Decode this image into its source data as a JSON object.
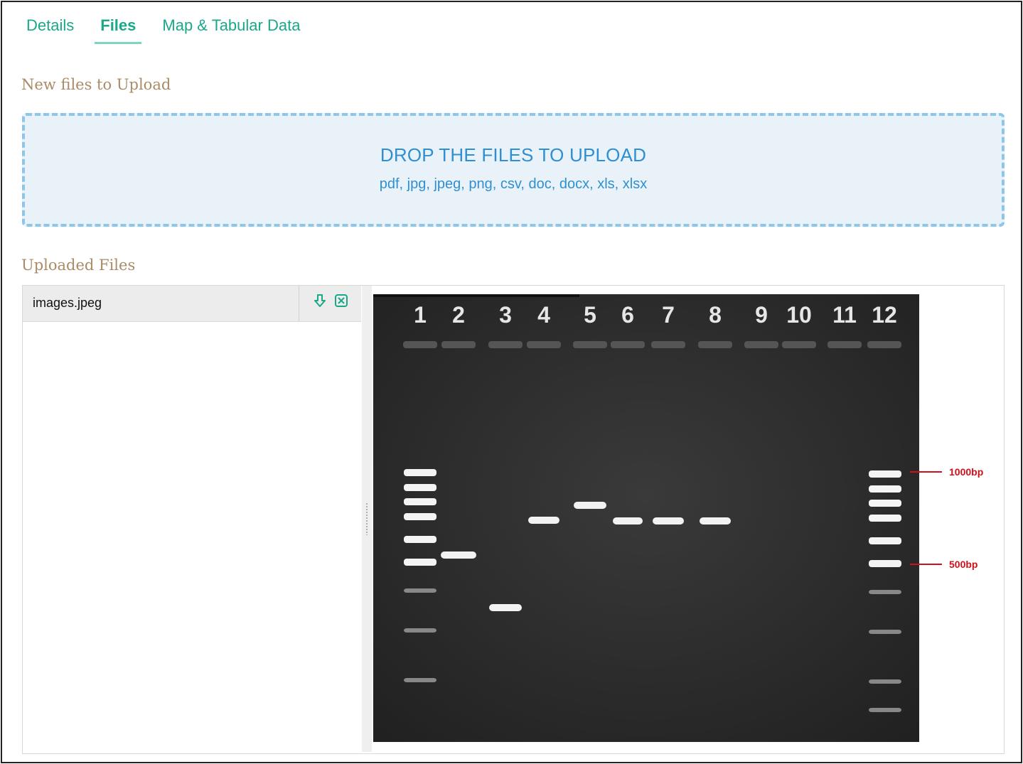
{
  "tabs": [
    "Details",
    "Files",
    "Map & Tabular Data"
  ],
  "active_tab": "Files",
  "new_files": {
    "title": "New files to Upload",
    "drop_label": "DROP THE FILES TO UPLOAD",
    "formats": "pdf, jpg, jpeg, png, csv, doc, docx, xls, xlsx"
  },
  "uploaded": {
    "title": "Uploaded Files",
    "files": [
      {
        "name": "images.jpeg"
      }
    ]
  },
  "preview": {
    "lane_labels": [
      "1",
      "2",
      "3",
      "4",
      "5",
      "6",
      "7",
      "8",
      "9",
      "10",
      "11",
      "12"
    ],
    "marker_labels": [
      "1000bp",
      "500bp"
    ]
  },
  "colors": {
    "accent": "#1aa88a",
    "drop_text": "#2f8fd0",
    "section": "#a98b68",
    "marker": "#d0101a"
  },
  "icons": {
    "download": "download-icon",
    "remove": "remove-icon"
  }
}
